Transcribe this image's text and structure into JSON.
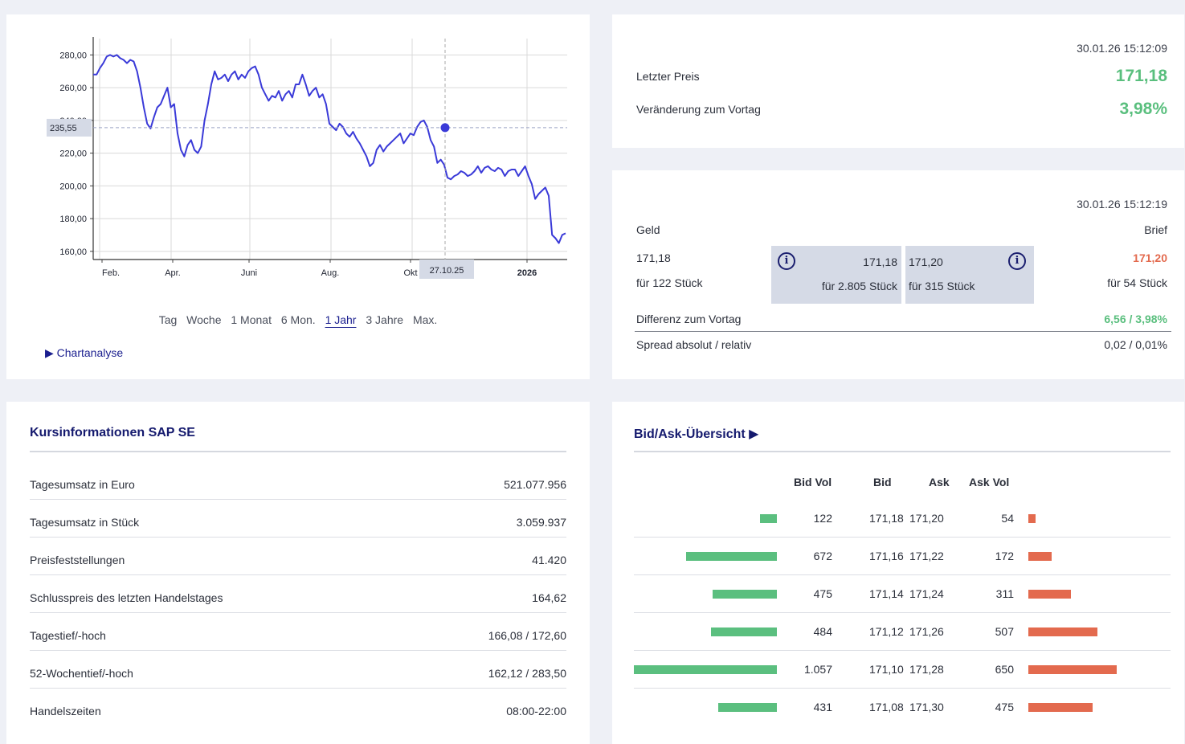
{
  "chart": {
    "y_ticks": [
      "280,00",
      "260,00",
      "240,00",
      "220,00",
      "200,00",
      "180,00",
      "160,00"
    ],
    "x_ticks": [
      "Feb.",
      "Apr.",
      "Juni",
      "Aug.",
      "Okt",
      "2026"
    ],
    "crosshair_y_label": "235,55",
    "crosshair_x_label": "27.10.25",
    "ranges": [
      "Tag",
      "Woche",
      "1 Monat",
      "6 Mon.",
      "1 Jahr",
      "3 Jahre",
      "Max."
    ],
    "active_range": "1 Jahr",
    "analysis_link": "▶ Chartanalyse",
    "line_color": "#3a3ad8"
  },
  "chart_data": {
    "type": "line",
    "ylim": [
      155,
      290
    ],
    "grid": true,
    "series": [
      {
        "values": [
          268,
          268,
          272,
          275,
          279,
          280,
          279,
          280,
          278,
          277,
          275,
          277,
          276,
          270,
          260,
          248,
          238,
          235,
          242,
          248,
          250,
          255,
          260,
          248,
          250,
          232,
          222,
          218,
          225,
          228,
          222,
          220,
          224,
          240,
          250,
          262,
          270,
          265,
          266,
          268,
          264,
          268,
          270,
          265,
          268,
          266,
          270,
          272,
          273,
          268,
          260,
          256,
          252,
          255,
          254,
          258,
          252,
          256,
          258,
          254,
          262,
          262,
          268,
          262,
          255,
          258,
          260,
          254,
          256,
          250,
          238,
          236,
          234,
          238,
          236,
          232,
          230,
          233,
          229,
          226,
          222,
          218,
          212,
          214,
          222,
          225,
          221,
          224,
          226,
          228,
          230,
          232,
          226,
          229,
          232,
          231,
          236,
          239,
          240,
          236,
          228,
          224,
          214,
          216,
          213,
          205,
          204,
          206,
          207,
          209,
          208,
          206,
          207,
          209,
          212,
          208,
          211,
          212,
          210,
          209,
          211,
          210,
          206,
          209,
          210,
          210,
          206,
          209,
          212,
          206,
          201,
          192,
          195,
          197,
          199,
          194,
          170,
          168,
          165,
          170,
          171
        ]
      }
    ]
  },
  "price": {
    "timestamp": "30.01.26 15:12:09",
    "last_label": "Letzter Preis",
    "last_value": "171,18",
    "change_label": "Veränderung zum Vortag",
    "change_value": "3,98%"
  },
  "quote": {
    "timestamp": "30.01.26 15:12:19",
    "geld_label": "Geld",
    "brief_label": "Brief",
    "geld_price": "171,18",
    "geld_qty": "für 122 Stück",
    "mid_bid_price": "171,18",
    "mid_bid_qty": "für 2.805 Stück",
    "mid_ask_price": "171,20",
    "mid_ask_qty": "für 315 Stück",
    "brief_price": "171,20",
    "brief_qty": "für 54 Stück",
    "diff_label": "Differenz zum Vortag",
    "diff_value": "6,56 / 3,98%",
    "spread_label": "Spread absolut / relativ",
    "spread_value": "0,02 / 0,01%",
    "info_icon": "i"
  },
  "kurs": {
    "title": "Kursinformationen SAP SE",
    "rows": [
      {
        "k": "Tagesumsatz in Euro",
        "v": "521.077.956"
      },
      {
        "k": "Tagesumsatz in Stück",
        "v": "3.059.937"
      },
      {
        "k": "Preisfeststellungen",
        "v": "41.420"
      },
      {
        "k": "Schlusspreis des letzten Handelstages",
        "v": "164,62"
      },
      {
        "k": "Tagestief/-hoch",
        "v": "166,08 / 172,60"
      },
      {
        "k": "52-Wochentief/-hoch",
        "v": "162,12 / 283,50"
      },
      {
        "k": "Handelszeiten",
        "v": "08:00-22:00"
      }
    ]
  },
  "bidask": {
    "title": "Bid/Ask-Übersicht ▶",
    "headers": [
      "Bid Vol",
      "Bid",
      "Ask",
      "Ask Vol"
    ],
    "rows": [
      {
        "bid_vol": "122",
        "bid": "171,18",
        "ask": "171,20",
        "ask_vol": "54"
      },
      {
        "bid_vol": "672",
        "bid": "171,16",
        "ask": "171,22",
        "ask_vol": "172"
      },
      {
        "bid_vol": "475",
        "bid": "171,14",
        "ask": "171,24",
        "ask_vol": "311"
      },
      {
        "bid_vol": "484",
        "bid": "171,12",
        "ask": "171,26",
        "ask_vol": "507"
      },
      {
        "bid_vol": "1.057",
        "bid": "171,10",
        "ask": "171,28",
        "ask_vol": "650"
      },
      {
        "bid_vol": "431",
        "bid": "171,08",
        "ask": "171,30",
        "ask_vol": "475"
      }
    ],
    "bid_color": "#5bbf7f",
    "ask_color": "#e36a4e"
  }
}
